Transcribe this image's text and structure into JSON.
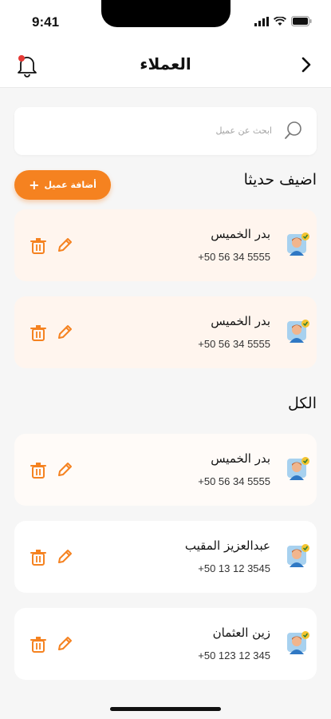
{
  "status": {
    "time": "9:41"
  },
  "header": {
    "title": "العملاء"
  },
  "search": {
    "placeholder": "ابحث عن عميل"
  },
  "recent": {
    "title": "اضيف حديثا",
    "add_label": "أضافة عميل",
    "items": [
      {
        "name": "بدر الخميس",
        "phone": "+50 56 34 5555"
      },
      {
        "name": "بدر الخميس",
        "phone": "+50 56 34 5555"
      }
    ]
  },
  "all": {
    "title": "الكل",
    "items": [
      {
        "name": "بدر الخميس",
        "phone": "+50 56 34 5555"
      },
      {
        "name": "عبدالعزيز المقيب",
        "phone": "+50 13 12 3545"
      },
      {
        "name": "زين العثمان",
        "phone": "+50 123 12 345"
      }
    ]
  },
  "colors": {
    "accent": "#f58220",
    "notification_dot": "#e53935",
    "recent_card_bg": "#fff5ee"
  },
  "icons": {
    "back": "chevron-right-icon",
    "bell": "bell-icon",
    "search": "search-icon",
    "trash": "trash-icon",
    "edit": "pencil-icon",
    "avatar": "user-avatar-icon"
  }
}
